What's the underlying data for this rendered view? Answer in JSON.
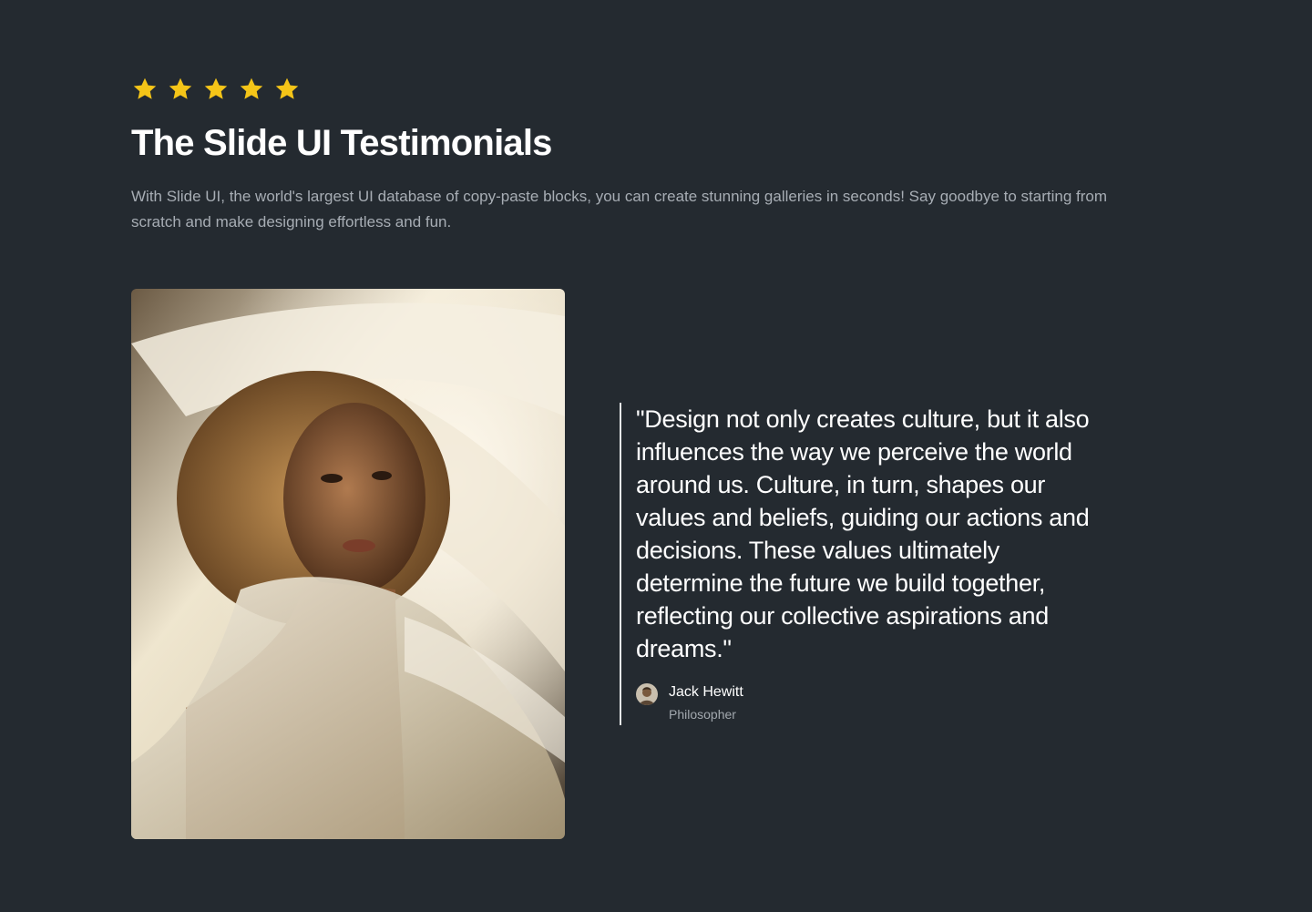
{
  "rating": {
    "stars": 5,
    "max": 5,
    "star_color": "#f5c518",
    "icon": "star-icon"
  },
  "header": {
    "title": "The Slide UI Testimonials",
    "description": "With Slide UI, the world's largest UI database of copy-paste blocks, you can create stunning galleries in seconds! Say goodbye to starting from scratch and make designing effortless and fun."
  },
  "testimonial": {
    "quote": "\"Design not only creates culture, but it also influences the way we perceive the world around us. Culture, in turn, shapes our values and beliefs, guiding our actions and decisions. These values ultimately determine the future we build together, reflecting our collective aspirations and dreams.\"",
    "author": {
      "name": "Jack Hewitt",
      "role": "Philosopher"
    }
  },
  "colors": {
    "background": "#242a30",
    "text_primary": "#ffffff",
    "text_muted": "#a7adb4",
    "accent_star": "#f5c518"
  }
}
